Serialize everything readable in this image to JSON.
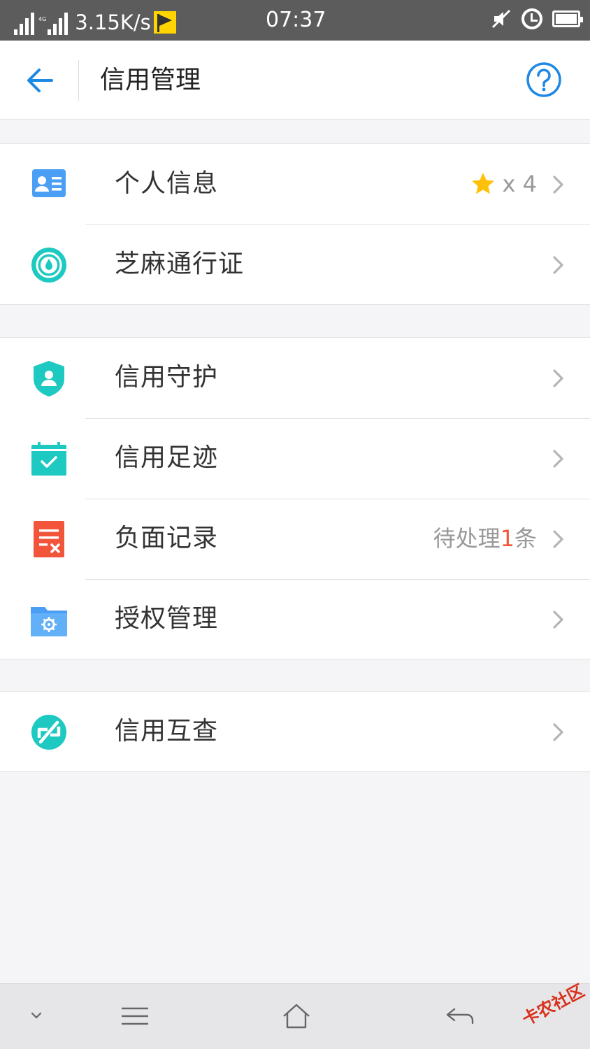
{
  "status_bar": {
    "network_type": "4G",
    "speed": "3.15K/s",
    "time": "07:37"
  },
  "header": {
    "title": "信用管理",
    "back_icon": "arrow-left-icon",
    "help_icon": "question-circle-icon"
  },
  "groups": [
    {
      "items": [
        {
          "label": "个人信息",
          "icon": "id-card-icon",
          "badge_icon": "star-icon",
          "badge_count": "x 4"
        },
        {
          "label": "芝麻通行证",
          "icon": "sesame-pass-icon"
        }
      ]
    },
    {
      "items": [
        {
          "label": "信用守护",
          "icon": "shield-user-icon"
        },
        {
          "label": "信用足迹",
          "icon": "calendar-check-icon"
        },
        {
          "label": "负面记录",
          "icon": "record-x-icon",
          "pending_prefix": "待处理",
          "pending_count": "1",
          "pending_suffix": "条"
        },
        {
          "label": "授权管理",
          "icon": "folder-gear-icon"
        }
      ]
    },
    {
      "items": [
        {
          "label": "信用互查",
          "icon": "mutual-check-icon"
        }
      ]
    }
  ],
  "nav_bar": {
    "icons": [
      "chevron-down-icon",
      "menu-icon",
      "home-icon",
      "back-icon"
    ]
  },
  "watermark": "卡农社区",
  "colors": {
    "accent_blue": "#1e88e5",
    "teal": "#1dc9c0",
    "red": "#f2553a",
    "star": "#ffc107"
  }
}
